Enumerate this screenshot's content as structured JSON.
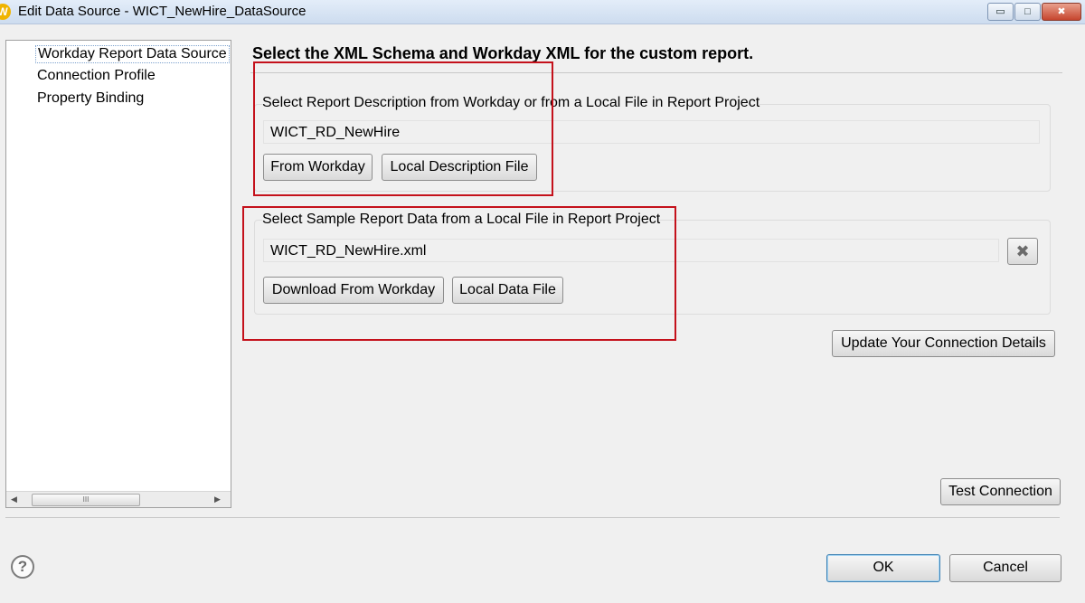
{
  "window": {
    "title": "Edit Data Source - WICT_NewHire_DataSource",
    "app_icon_letter": "W",
    "controls": {
      "minimize": "▭",
      "maximize": "□",
      "close": "✖"
    }
  },
  "nav": {
    "items": [
      {
        "label": "Workday Report Data Source",
        "selected": true
      },
      {
        "label": "Connection Profile",
        "selected": false
      },
      {
        "label": "Property Binding",
        "selected": false
      }
    ],
    "scroll_thumb": "III"
  },
  "main": {
    "heading": "Select the XML Schema and Workday XML for the custom report.",
    "report_description": {
      "label": "Select Report Description from Workday or from a Local File in Report Project",
      "value": "WICT_RD_NewHire",
      "from_workday_button": "From Workday",
      "local_description_button": "Local Description File"
    },
    "sample_data": {
      "label": "Select Sample Report Data from a Local File in Report Project",
      "value": "WICT_RD_NewHire.xml",
      "download_button": "Download From Workday",
      "local_data_button": "Local Data File",
      "clear_icon": "✖"
    },
    "update_connection_button": "Update Your Connection Details",
    "test_connection_button": "Test Connection"
  },
  "footer": {
    "help_icon": "?",
    "ok_button": "OK",
    "cancel_button": "Cancel"
  },
  "colors": {
    "highlight": "#c4111b",
    "title_bar": "#dae6f4",
    "dialog_bg": "#f0f0f0"
  }
}
